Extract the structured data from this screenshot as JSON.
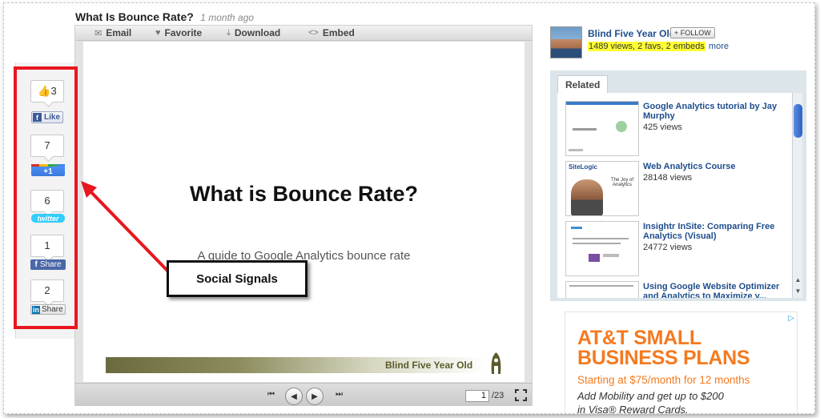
{
  "header": {
    "title": "What Is Bounce Rate?",
    "time": "1 month ago"
  },
  "toolbar": {
    "email": "Email",
    "favorite": "Favorite",
    "download": "Download",
    "embed": "Embed"
  },
  "slide": {
    "title": "What is Bounce Rate?",
    "subtitle": "A guide to Google Analytics bounce rate",
    "brand": "Blind Five Year Old"
  },
  "player": {
    "page": "1",
    "total": "/23"
  },
  "social": {
    "fb_like_count": "3",
    "fb_like_label": "Like",
    "gplus_count": "7",
    "gplus_label": "+1",
    "twitter_count": "6",
    "twitter_label": "twitter",
    "fb_share_count": "1",
    "fb_share_label": "Share",
    "linkedin_count": "2",
    "linkedin_in": "in",
    "linkedin_label": "Share"
  },
  "annotation": {
    "label": "Social Signals"
  },
  "author": {
    "name": "Blind Five Year Old",
    "follow": "+ FOLLOW",
    "stats": "1489 views, 2 favs, 2 embeds",
    "more": "more"
  },
  "related": {
    "tab": "Related",
    "items": [
      {
        "title": "Google Analytics tutorial by Jay Murphy",
        "views": "425 views"
      },
      {
        "title": "Web Analytics Course",
        "views": "28148 views",
        "thumb_brand": "SiteLogic",
        "thumb_text": "The Joy of Analytics"
      },
      {
        "title": "Insightr InSite: Comparing Free Analytics (Visual)",
        "views": "24772 views"
      },
      {
        "title": "Using Google Website Optimizer and Analytics to Maximize y...",
        "views": ""
      }
    ]
  },
  "ad": {
    "headline_1": "AT&T SMALL",
    "headline_2": "BUSINESS PLANS",
    "price": "Starting at $75/month for 12 months",
    "body_1": "Add Mobility and get up to $200",
    "body_2": "in Visa® Reward Cards."
  },
  "colors": {
    "highlight": "#ffff33",
    "link": "#1e4d8c",
    "annotation_red": "#e8161e",
    "ad_orange": "#f47a20"
  }
}
